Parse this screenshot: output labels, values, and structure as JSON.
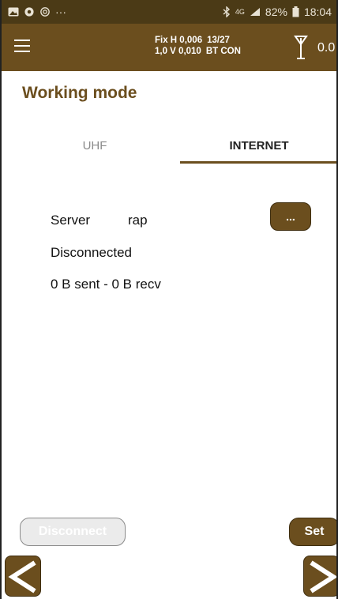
{
  "status_bar": {
    "network": "4G",
    "battery": "82%",
    "time": "18:04",
    "overflow": "···"
  },
  "app_bar": {
    "fix_line1_a": "Fix H 0,006",
    "fix_line1_b": "13/27",
    "fix_line2_a": "1,0 V 0,010",
    "fix_line2_b": "BT CON",
    "value": "0.0"
  },
  "page": {
    "title": "Working mode"
  },
  "tabs": [
    {
      "label": "UHF",
      "selected": false
    },
    {
      "label": "INTERNET",
      "selected": true
    }
  ],
  "connection": {
    "server_label": "Server",
    "server_name": "rap",
    "more_button": "...",
    "status": "Disconnected",
    "traffic": "0 B sent - 0 B recv"
  },
  "actions": {
    "disconnect_label": "Disconnect",
    "set_label": "Set"
  },
  "colors": {
    "brand": "#6b4e1e",
    "status_bar": "#4b3a16"
  },
  "icons": {
    "menu": "hamburger-icon",
    "antenna": "antenna-icon",
    "prev": "chevron-left-icon",
    "next": "chevron-right-icon"
  }
}
